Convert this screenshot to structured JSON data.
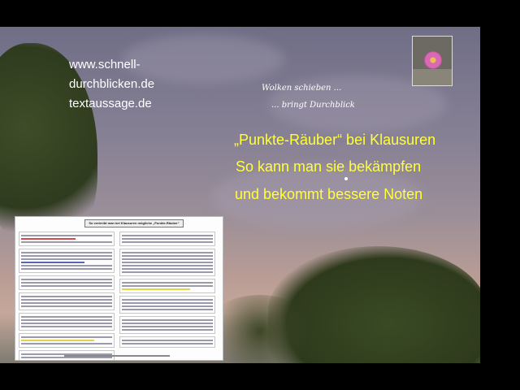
{
  "urls": [
    "www.schnell-",
    "durchblicken.de",
    "textaussage.de"
  ],
  "slogan": {
    "line1": "Wolken schieben ...",
    "line2": "... bringt Durchblick"
  },
  "headline": {
    "line1": "„Punkte-Räuber“ bei Klausuren",
    "line2": "So kann man sie bekämpfen",
    "line3": "und bekommt bessere Noten"
  },
  "document": {
    "title": "So vertreibt man bei Klausuren mögliche „Punkte-Räuber“"
  },
  "colors": {
    "headline": "#ffff3a",
    "text": "#ffffff",
    "background_frame": "#000000"
  }
}
